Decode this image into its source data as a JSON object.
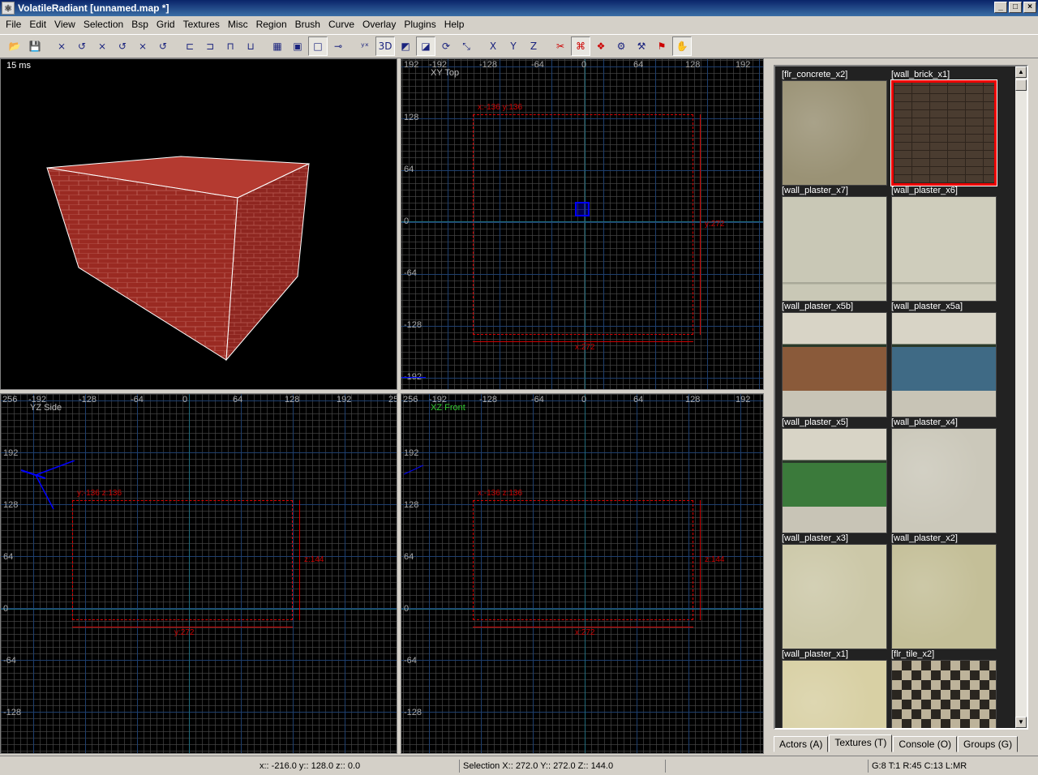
{
  "window": {
    "title": "VolatileRadiant [unnamed.map *]"
  },
  "menu": [
    "File",
    "Edit",
    "View",
    "Selection",
    "Bsp",
    "Grid",
    "Textures",
    "Misc",
    "Region",
    "Brush",
    "Curve",
    "Overlay",
    "Plugins",
    "Help"
  ],
  "toolbar": {
    "buttons": [
      {
        "name": "open-icon",
        "glyph": "📂"
      },
      {
        "name": "save-icon",
        "glyph": "💾"
      },
      {
        "sep": true
      },
      {
        "name": "flip-x-icon",
        "glyph": "⨯"
      },
      {
        "name": "rotate-x-icon",
        "glyph": "↺"
      },
      {
        "name": "flip-y-icon",
        "glyph": "⨯"
      },
      {
        "name": "rotate-y-icon",
        "glyph": "↺"
      },
      {
        "name": "flip-z-icon",
        "glyph": "⨯"
      },
      {
        "name": "rotate-z-icon",
        "glyph": "↺"
      },
      {
        "sep": true
      },
      {
        "name": "select-complete-tall-icon",
        "glyph": "⊏"
      },
      {
        "name": "select-touching-icon",
        "glyph": "⊐"
      },
      {
        "name": "select-partial-tall-icon",
        "glyph": "⊓"
      },
      {
        "name": "select-inside-icon",
        "glyph": "⊔"
      },
      {
        "sep": true
      },
      {
        "name": "csg-subtract-icon",
        "glyph": "▦"
      },
      {
        "name": "csg-merge-icon",
        "glyph": "▣"
      },
      {
        "name": "make-hollow-icon",
        "glyph": "□",
        "on": true
      },
      {
        "name": "clipper-icon",
        "glyph": "⊸"
      },
      {
        "sep": true
      },
      {
        "name": "change-views-icon",
        "glyph": "ʸˣ"
      },
      {
        "name": "cubic-clip-icon",
        "glyph": "3D",
        "on": true
      },
      {
        "name": "camera-preview-icon",
        "glyph": "◩"
      },
      {
        "name": "texture-lock-icon",
        "glyph": "◪",
        "on": true
      },
      {
        "name": "rotate-tool-icon",
        "glyph": "⟳"
      },
      {
        "name": "scale-tool-icon",
        "glyph": "⤡"
      },
      {
        "sep": true
      },
      {
        "name": "view-xy-icon",
        "glyph": "X"
      },
      {
        "name": "view-yz-icon",
        "glyph": "Y"
      },
      {
        "name": "view-xz-icon",
        "glyph": "Z"
      },
      {
        "sep": true
      },
      {
        "name": "patch-tool-icon",
        "glyph": "✂",
        "red": true
      },
      {
        "name": "patch-select-icon",
        "glyph": "⌘",
        "red": true,
        "on": true
      },
      {
        "name": "bend-icon",
        "glyph": "❖",
        "red": true
      },
      {
        "name": "weld-icon",
        "glyph": "⚙"
      },
      {
        "name": "drill-icon",
        "glyph": "⚒"
      },
      {
        "name": "dock-icon",
        "glyph": "⚑",
        "red": true
      },
      {
        "name": "plugin-icon",
        "glyph": "✋",
        "on": true
      }
    ]
  },
  "camera": {
    "timing": "15 ms"
  },
  "views": {
    "xy": {
      "name": "XY Top",
      "top_labels": [
        "-192",
        "-128",
        "-64",
        "0",
        "64",
        "128",
        "192"
      ],
      "left_labels": [
        "192",
        "128",
        "64",
        "0",
        "-64",
        "-128",
        "-192"
      ],
      "sel_top": "x:-136  y:136",
      "sel_right": "y:272",
      "sel_bottom": "x:272"
    },
    "yz": {
      "name": "YZ Side",
      "top_labels": [
        "256",
        "-192",
        "-128",
        "-64",
        "0",
        "64",
        "128",
        "192",
        "256"
      ],
      "left_labels": [
        "192",
        "128",
        "64",
        "0",
        "-64",
        "-128"
      ],
      "sel_top": "y:-136  z:136",
      "sel_right": "z:144",
      "sel_bottom": "y:272"
    },
    "xz": {
      "name": "XZ Front",
      "top_labels": [
        "256",
        "-192",
        "-128",
        "-64",
        "0",
        "64",
        "128",
        "192"
      ],
      "left_labels": [
        "192",
        "128",
        "64",
        "0",
        "-64",
        "-128"
      ],
      "sel_top": "x:-136  z:136",
      "sel_right": "z:144",
      "sel_bottom": "x:272"
    }
  },
  "textures": [
    {
      "name": "[flr_concrete_x2]",
      "color": "#9a9275"
    },
    {
      "name": "[wall_brick_x1]",
      "color": "#4a3c30",
      "selected": true
    },
    {
      "name": "[wall_plaster_x7]",
      "color": "#c9c8b6"
    },
    {
      "name": "[wall_plaster_x6]",
      "color": "#cfcdbc"
    },
    {
      "name": "[wall_plaster_x5b]",
      "color": "#8a5a3a"
    },
    {
      "name": "[wall_plaster_x5a]",
      "color": "#3f6a85"
    },
    {
      "name": "[wall_plaster_x5]",
      "color": "#3b7a3b"
    },
    {
      "name": "[wall_plaster_x4]",
      "color": "#cbc8ba"
    },
    {
      "name": "[wall_plaster_x3]",
      "color": "#ccc8a8"
    },
    {
      "name": "[wall_plaster_x2]",
      "color": "#c4bf98"
    },
    {
      "name": "[wall_plaster_x1]",
      "color": "#d8d0a4"
    },
    {
      "name": "[flr_tile_x2]",
      "color": "#6a6252"
    }
  ],
  "tabs": [
    "Actors (A)",
    "Textures (T)",
    "Console (O)",
    "Groups (G)"
  ],
  "active_tab": "Textures (T)",
  "status": {
    "coords": "x:: -216.0  y:: 128.0  z:: 0.0",
    "selection": "Selection X:: 272.0  Y:: 272.0  Z:: 144.0",
    "grid": "G:8 T:1 R:45 C:13 L:MR"
  },
  "colors": {
    "selection": "#dd0000",
    "brick": "#9a2a22",
    "accent": "#0a246a"
  }
}
